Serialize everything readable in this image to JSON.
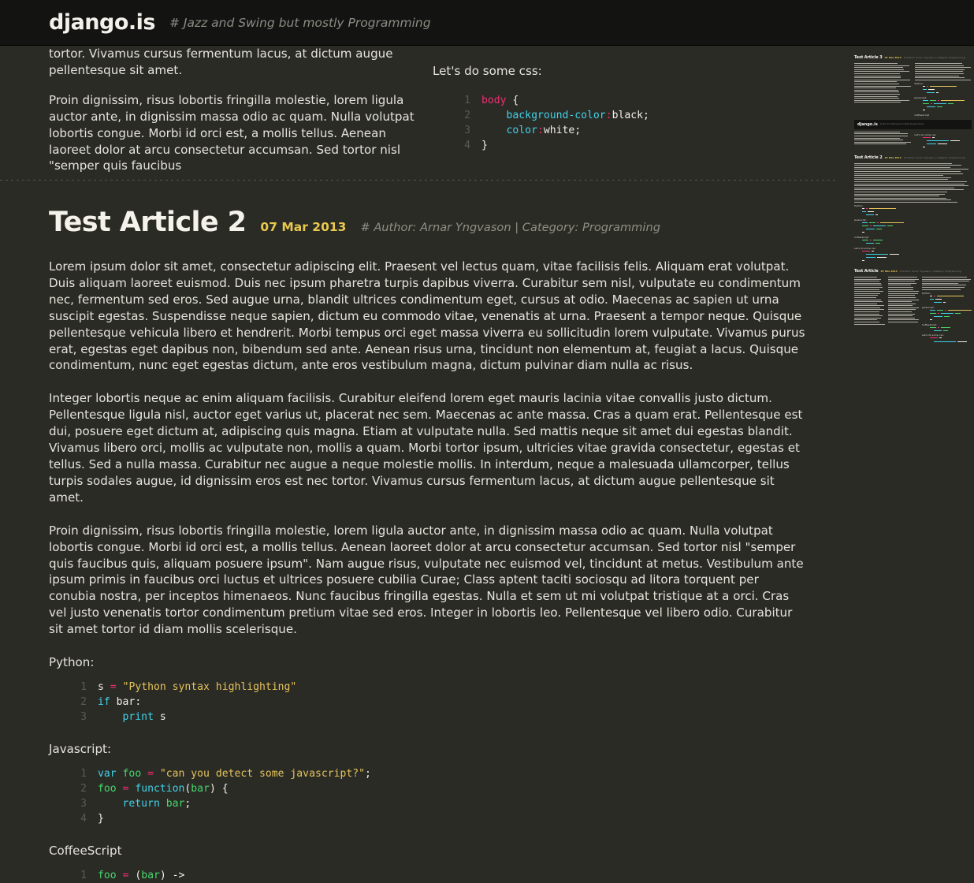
{
  "header": {
    "brand": "django.is",
    "tagline": "# Jazz and Swing but mostly Programming"
  },
  "previous_article_tail": {
    "left_paragraphs": [
      "tortor. Vivamus cursus fermentum lacus, at dictum augue pellentesque sit amet.",
      "Proin dignissim, risus lobortis fringilla molestie, lorem ligula auctor ante, in dignissim massa odio ac quam. Nulla volutpat lobortis congue. Morbi id orci est, a mollis tellus. Aenean laoreet dolor at arcu consectetur accumsan. Sed tortor nisl \"semper quis faucibus"
    ],
    "css_label": "Let's do some css:",
    "css_code": [
      {
        "n": "1",
        "tokens": [
          {
            "t": "body",
            "c": "sel"
          },
          {
            "t": " {",
            "c": "pl"
          }
        ]
      },
      {
        "n": "2",
        "tokens": [
          {
            "t": "    background-color",
            "c": "prop"
          },
          {
            "t": ":",
            "c": "op"
          },
          {
            "t": "black;",
            "c": "val"
          }
        ]
      },
      {
        "n": "3",
        "tokens": [
          {
            "t": "    color",
            "c": "prop"
          },
          {
            "t": ":",
            "c": "op"
          },
          {
            "t": "white;",
            "c": "val"
          }
        ]
      },
      {
        "n": "4",
        "tokens": [
          {
            "t": "}",
            "c": "pl"
          }
        ]
      }
    ]
  },
  "article": {
    "title": "Test Article 2",
    "date": "07 Mar 2013",
    "meta": "# Author: Arnar Yngvason | Category: Programming",
    "paragraphs": [
      "Lorem ipsum dolor sit amet, consectetur adipiscing elit. Praesent vel lectus quam, vitae facilisis felis. Aliquam erat volutpat. Duis aliquam laoreet euismod. Duis nec ipsum pharetra turpis dapibus viverra. Curabitur sem nisl, vulputate eu condimentum nec, fermentum sed eros. Sed augue urna, blandit ultrices condimentum eget, cursus at odio. Maecenas ac sapien ut urna suscipit egestas. Suspendisse neque sapien, dictum eu commodo vitae, venenatis at urna. Praesent a tempor neque. Quisque pellentesque vehicula libero et hendrerit. Morbi tempus orci eget massa viverra eu sollicitudin lorem vulputate. Vivamus purus erat, egestas eget dapibus non, bibendum sed ante. Aenean risus urna, tincidunt non elementum at, feugiat a lacus. Quisque condimentum, nunc eget egestas dictum, ante eros vestibulum magna, dictum pulvinar diam nulla ac risus.",
      "Integer lobortis neque ac enim aliquam facilisis. Curabitur eleifend lorem eget mauris lacinia vitae convallis justo dictum. Pellentesque ligula nisl, auctor eget varius ut, placerat nec sem. Maecenas ac ante massa. Cras a quam erat. Pellentesque est dui, posuere eget dictum at, adipiscing quis magna. Etiam at vulputate nulla. Sed mattis neque sit amet dui egestas blandit. Vivamus libero orci, mollis ac vulputate non, mollis a quam. Morbi tortor ipsum, ultricies vitae gravida consectetur, egestas et tellus. Sed a nulla massa. Curabitur nec augue a neque molestie mollis. In interdum, neque a malesuada ullamcorper, tellus turpis sodales augue, id dignissim eros est nec tortor. Vivamus cursus fermentum lacus, at dictum augue pellentesque sit amet.",
      "Proin dignissim, risus lobortis fringilla molestie, lorem ligula auctor ante, in dignissim massa odio ac quam. Nulla volutpat lobortis congue. Morbi id orci est, a mollis tellus. Aenean laoreet dolor at arcu consectetur accumsan. Sed tortor nisl \"semper quis faucibus quis, aliquam posuere ipsum\". Nam augue risus, vulputate nec euismod vel, tincidunt at metus. Vestibulum ante ipsum primis in faucibus orci luctus et ultrices posuere cubilia Curae; Class aptent taciti sociosqu ad litora torquent per conubia nostra, per inceptos himenaeos. Nunc faucibus fringilla egestas. Nulla et sem ut mi volutpat tristique at a orci. Cras vel justo venenatis tortor condimentum pretium vitae sed eros. Integer in lobortis leo. Pellentesque vel libero odio. Curabitur sit amet tortor id diam mollis scelerisque."
    ],
    "python_label": "Python:",
    "python_code": [
      {
        "n": "1",
        "tokens": [
          {
            "t": "s ",
            "c": "val"
          },
          {
            "t": "=",
            "c": "op"
          },
          {
            "t": " ",
            "c": "pl"
          },
          {
            "t": "\"Python syntax highlighting\"",
            "c": "str"
          }
        ]
      },
      {
        "n": "2",
        "tokens": [
          {
            "t": "if",
            "c": "kw"
          },
          {
            "t": " bar:",
            "c": "val"
          }
        ]
      },
      {
        "n": "3",
        "tokens": [
          {
            "t": "    print",
            "c": "kw"
          },
          {
            "t": " s",
            "c": "val"
          }
        ]
      }
    ],
    "javascript_label": "Javascript:",
    "javascript_code": [
      {
        "n": "1",
        "tokens": [
          {
            "t": "var",
            "c": "kw"
          },
          {
            "t": " ",
            "c": "pl"
          },
          {
            "t": "foo",
            "c": "name"
          },
          {
            "t": " ",
            "c": "pl"
          },
          {
            "t": "=",
            "c": "op"
          },
          {
            "t": " ",
            "c": "pl"
          },
          {
            "t": "\"can you detect some javascript?\"",
            "c": "str"
          },
          {
            "t": ";",
            "c": "pl"
          }
        ]
      },
      {
        "n": "2",
        "tokens": [
          {
            "t": "foo",
            "c": "name"
          },
          {
            "t": " ",
            "c": "pl"
          },
          {
            "t": "=",
            "c": "op"
          },
          {
            "t": " ",
            "c": "pl"
          },
          {
            "t": "function",
            "c": "kw"
          },
          {
            "t": "(",
            "c": "pl"
          },
          {
            "t": "bar",
            "c": "name"
          },
          {
            "t": ") {",
            "c": "pl"
          }
        ]
      },
      {
        "n": "3",
        "tokens": [
          {
            "t": "    return",
            "c": "kw"
          },
          {
            "t": " ",
            "c": "pl"
          },
          {
            "t": "bar",
            "c": "name"
          },
          {
            "t": ";",
            "c": "pl"
          }
        ]
      },
      {
        "n": "4",
        "tokens": [
          {
            "t": "}",
            "c": "pl"
          }
        ]
      }
    ],
    "coffeescript_label": "CoffeeScript",
    "coffeescript_code": [
      {
        "n": "1",
        "tokens": [
          {
            "t": "foo",
            "c": "name"
          },
          {
            "t": " ",
            "c": "pl"
          },
          {
            "t": "=",
            "c": "op"
          },
          {
            "t": " (",
            "c": "pl"
          },
          {
            "t": "bar",
            "c": "name"
          },
          {
            "t": ") ->",
            "c": "pl"
          }
        ]
      }
    ]
  },
  "minimap": {
    "label": "page-overview-minimap",
    "sections": [
      {
        "title": "Test Article 3",
        "date": "07 Mar 2013",
        "meta": "# Author: Arnar Yngvason | Category: Programming"
      },
      {
        "title": "Test Article 2",
        "date": "07 Mar 2013",
        "meta": "# Author: Arnar Yngvason | Category: Programming"
      },
      {
        "title": "Test Article",
        "date": "07 Mar 2013",
        "meta": "# Author: Arnar Yngvason | Category: Programming"
      }
    ],
    "brand": "django.is",
    "brand_tagline": "# Jazz and Swing but mostly Programming"
  },
  "colors": {
    "page_bg": "#2b2b26",
    "header_bg": "#131312",
    "text": "#e6e4dc",
    "accent_date": "#e8c84d",
    "accent_pink": "#ef2d71",
    "accent_cyan": "#3fd2e8",
    "accent_green": "#46d66c",
    "accent_string": "#e5c35a",
    "muted": "#8d8d84"
  }
}
